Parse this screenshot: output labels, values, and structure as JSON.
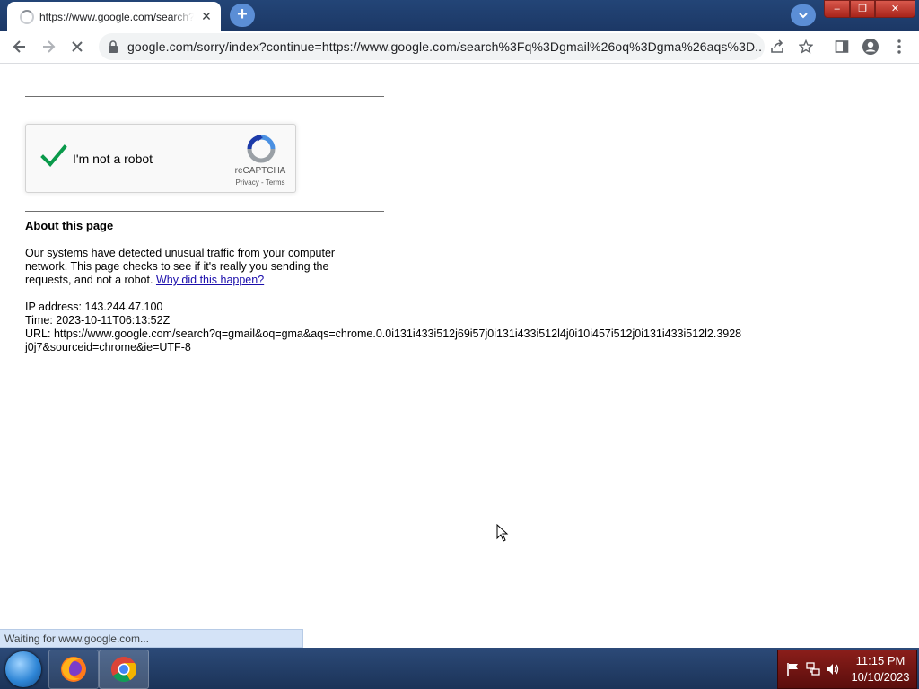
{
  "browser": {
    "tab": {
      "title": "https://www.google.com/search?q=gmail&oq=gma&aqs=chrome",
      "close_glyph": "✕"
    },
    "new_tab_glyph": "+",
    "window_controls": {
      "minimize": "–",
      "maximize": "❐",
      "close": "✕"
    },
    "address": "google.com/sorry/index?continue=https://www.google.com/search%3Fq%3Dgmail%26oq%3Dgma%26aqs%3D..."
  },
  "page": {
    "recaptcha": {
      "label": "I'm not a robot",
      "brand": "reCAPTCHA",
      "links": "Privacy - Terms"
    },
    "about_title": "About this page",
    "paragraph": "Our systems have detected unusual traffic from your computer network. This page checks to see if it's really you sending the requests, and not a robot.",
    "why_link": "Why did this happen?",
    "ip_line": "IP address: 143.244.47.100",
    "time_line": "Time: 2023-10-11T06:13:52Z",
    "url_line": "URL: https://www.google.com/search?q=gmail&oq=gma&aqs=chrome.0.0i131i433i512j69i57j0i131i433i512l4j0i10i457i512j0i131i433i512l2.3928j0j7&sourceid=chrome&ie=UTF-8"
  },
  "status_text": "Waiting for www.google.com...",
  "taskbar": {
    "apps": [
      "firefox-icon",
      "chrome-icon"
    ],
    "time": "11:15 PM",
    "date": "10/10/2023"
  },
  "colors": {
    "titlebar": "#1f3c6e",
    "link": "#1a0dab",
    "check_green": "#0a9a4b",
    "tray_red": "#8a1e1a"
  }
}
